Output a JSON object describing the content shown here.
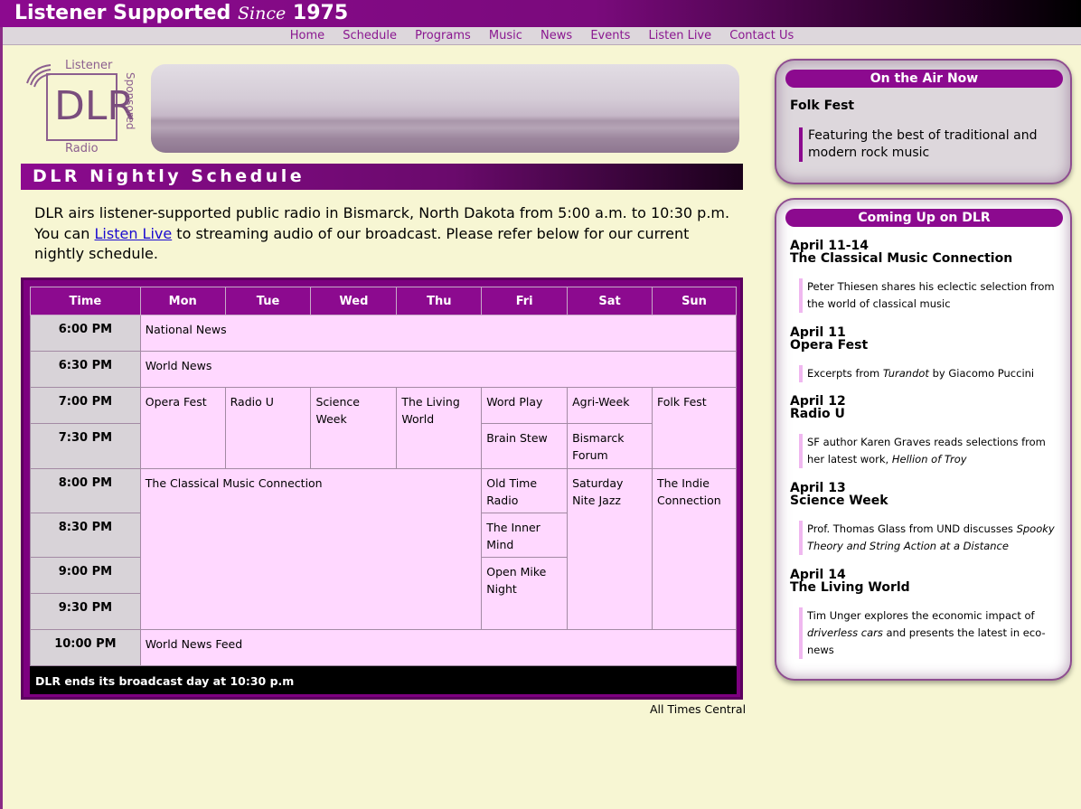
{
  "header": {
    "title_a": "Listener Supported",
    "title_since": "Since",
    "title_year": "1975"
  },
  "nav": [
    "Home",
    "Schedule",
    "Programs",
    "Music",
    "News",
    "Events",
    "Listen Live",
    "Contact Us"
  ],
  "logo": {
    "top": "Listener",
    "letters": "DLR",
    "side": "Sponsored",
    "bottom": "Radio"
  },
  "schedule": {
    "heading": "DLR Nightly Schedule",
    "intro_pre": "DLR airs listener-supported public radio in Bismarck, North Dakota from 5:00 a.m. to 10:30 p.m. You can ",
    "intro_link": "Listen Live",
    "intro_post": " to streaming audio of our broadcast. Please refer below for our current nightly schedule.",
    "columns": [
      "Time",
      "Mon",
      "Tue",
      "Wed",
      "Thu",
      "Fri",
      "Sat",
      "Sun"
    ],
    "times": [
      "6:00 PM",
      "6:30 PM",
      "7:00 PM",
      "7:30 PM",
      "8:00 PM",
      "8:30 PM",
      "9:00 PM",
      "9:30 PM",
      "10:00 PM"
    ],
    "shows": {
      "national_news": "National News",
      "world_news": "World News",
      "opera_fest": "Opera Fest",
      "radio_u": "Radio U",
      "science_week": "Science Week",
      "living_world": "The Living World",
      "word_play": "Word Play",
      "agri_week": "Agri-Week",
      "folk_fest": "Folk Fest",
      "brain_stew": "Brain Stew",
      "bismarck_forum": "Bismarck Forum",
      "classical": "The Classical Music Connection",
      "old_time_radio": "Old Time Radio",
      "saturday_jazz": "Saturday Nite Jazz",
      "indie": "The Indie Connection",
      "inner_mind": "The Inner Mind",
      "open_mike": "Open Mike Night",
      "world_news_feed": "World News Feed"
    },
    "footer": "DLR ends its broadcast day at 10:30 p.m",
    "note": "All Times Central"
  },
  "on_air": {
    "heading": "On the Air Now",
    "title": "Folk Fest",
    "desc": "Featuring the best of traditional and modern rock music"
  },
  "coming_up": {
    "heading": "Coming Up on DLR",
    "items": [
      {
        "date": "April 11-14",
        "show": "The Classical Music Connection",
        "desc": "Peter Thiesen shares his eclectic selection from the world of classical music"
      },
      {
        "date": "April 11",
        "show": "Opera Fest",
        "desc_pre": "Excerpts from ",
        "desc_em": "Turandot",
        "desc_post": " by Giacomo Puccini"
      },
      {
        "date": "April 12",
        "show": "Radio U",
        "desc_pre": "SF author Karen Graves reads selections from her latest work, ",
        "desc_em": "Hellion of Troy",
        "desc_post": ""
      },
      {
        "date": "April 13",
        "show": "Science Week",
        "desc_pre": "Prof. Thomas Glass from UND discusses ",
        "desc_em": "Spooky Theory and String Action at a Distance",
        "desc_post": ""
      },
      {
        "date": "April 14",
        "show": "The Living World",
        "desc_pre": "Tim Unger explores the economic impact of ",
        "desc_em": "driverless cars",
        "desc_post": " and presents the latest in eco-news"
      }
    ]
  },
  "colors": {
    "purple": "#8c0a8f",
    "cream": "#f7f6d3",
    "cell": "#ffd8ff",
    "time_cell": "#d8d3d8"
  }
}
